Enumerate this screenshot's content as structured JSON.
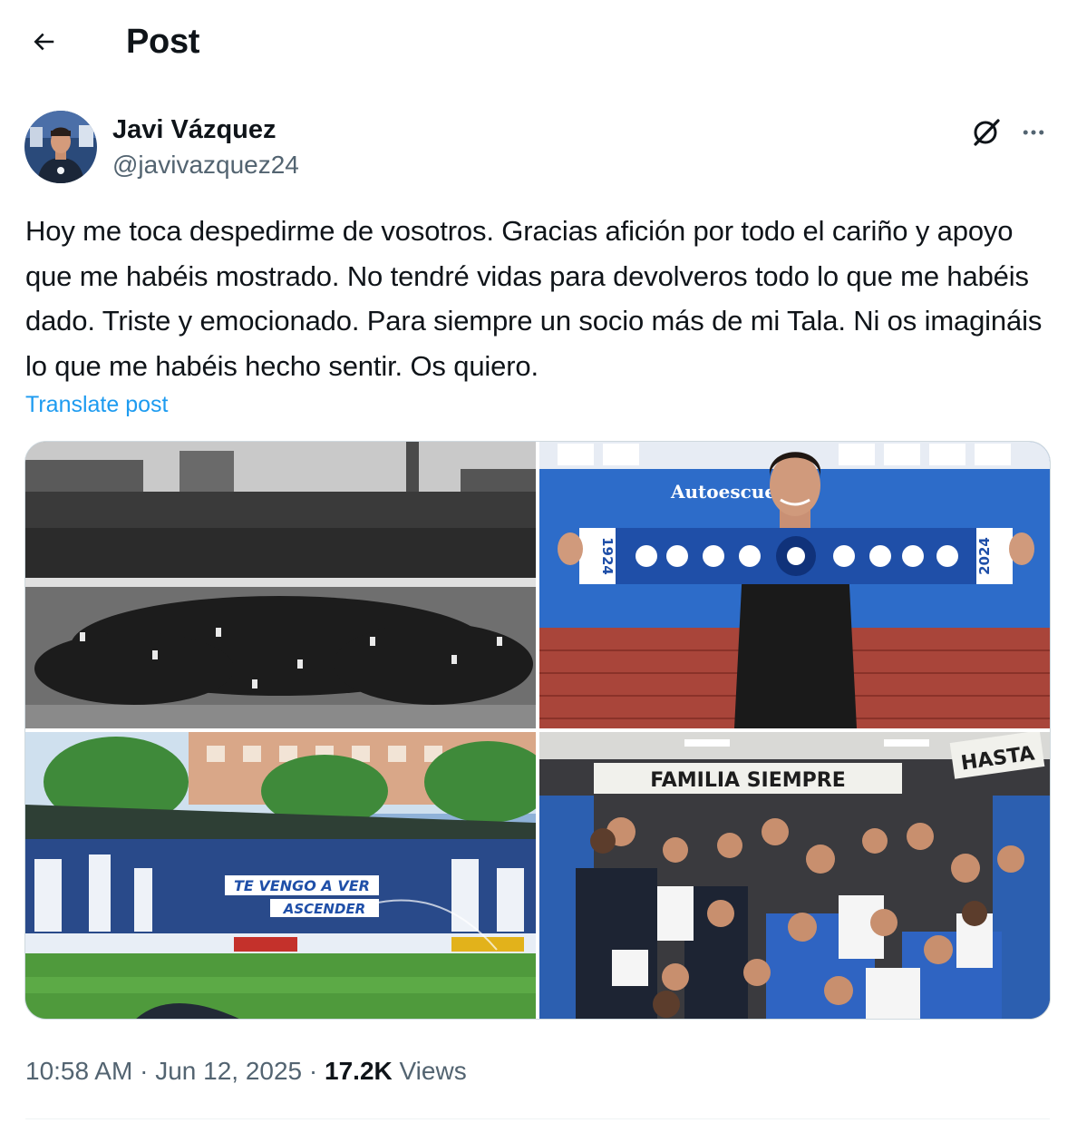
{
  "header": {
    "title": "Post",
    "back_icon": "arrow-left-icon"
  },
  "author": {
    "name": "Javi Vázquez",
    "handle": "@javivazquez24"
  },
  "actions": {
    "grok_icon": "grok-icon",
    "more_icon": "more-horizontal-icon"
  },
  "post": {
    "text": "Hoy me toca despedirme de vosotros. Gracias afición por todo el cariño y apoyo que me habéis mostrado. No tendré vidas para devolveros todo lo que me habéis dado. Triste y emocionado. Para siempre un socio más de mi Tala. Ni os imagináis lo que me habéis hecho sentir. Os quiero.",
    "translate_label": "Translate post"
  },
  "media": {
    "photo_tr": {
      "sign_text": "Autoescue",
      "scarf_year_left": "1924",
      "scarf_year_right": "2024"
    },
    "photo_bl": {
      "banner_line1": "TE VENGO A VER",
      "banner_line2": "ASCENDER"
    },
    "photo_br": {
      "wall_text": "FAMILIA SIEMPRE",
      "wall_text_right": "HASTA"
    }
  },
  "meta": {
    "time": "10:58 AM",
    "separator": " · ",
    "date": "Jun 12, 2025",
    "views_count": "17.2K",
    "views_label": "Views"
  },
  "colors": {
    "accent": "#1d9bf0",
    "text_primary": "#0f1419",
    "text_secondary": "#536471",
    "border": "#cfd9de"
  }
}
